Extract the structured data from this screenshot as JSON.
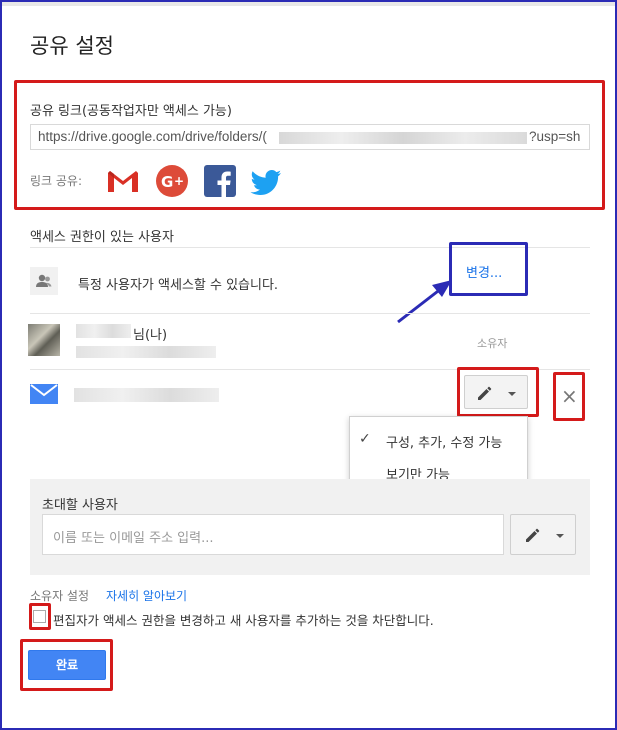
{
  "dialog": {
    "title": "공유 설정"
  },
  "share_link": {
    "heading": "공유 링크(공동작업자만 액세스 가능)",
    "url_start": "https://drive.google.com/drive/folders/(",
    "url_end": "?usp=sh",
    "share_via_label": "링크 공유:",
    "share_targets": [
      {
        "name": "Gmail",
        "icon": "gmail-icon"
      },
      {
        "name": "Google+",
        "icon": "google-plus-icon"
      },
      {
        "name": "Facebook",
        "icon": "facebook-icon"
      },
      {
        "name": "Twitter",
        "icon": "twitter-icon"
      }
    ]
  },
  "access": {
    "heading": "액세스 권한이 있는 사용자",
    "visibility_text": "특정 사용자가 액세스할 수 있습니다.",
    "change_link": "변경...",
    "owner": {
      "name_suffix": "님(나)",
      "role": "소유자"
    }
  },
  "permission_menu": {
    "items": [
      {
        "label": "구성, 추가, 수정 가능",
        "checked": true
      },
      {
        "label": "보기만 가능",
        "checked": false
      }
    ]
  },
  "invite": {
    "heading": "초대할 사용자",
    "placeholder": "이름 또는 이메일 주소 입력..."
  },
  "owner_settings": {
    "label": "소유자 설정",
    "learn_more": "자세히 알아보기",
    "block_editors_text": "편집자가 액세스 권한을 변경하고 새 사용자를 추가하는 것을 차단합니다.",
    "block_editors_checked": false
  },
  "footer": {
    "done_label": "완료"
  },
  "colors": {
    "annotation_red": "#d41a1a",
    "annotation_blue": "#2b2bb5",
    "primary_blue": "#4285f4",
    "link_blue": "#1a73e8"
  }
}
